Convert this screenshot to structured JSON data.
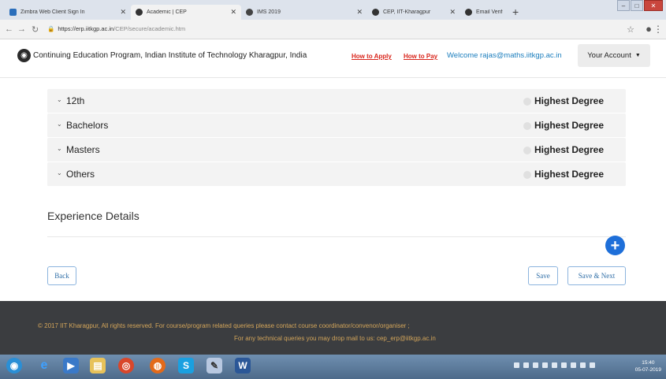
{
  "browser": {
    "tabs": [
      {
        "title": "Zimbra Web Client Sign In",
        "color": "#2a6ebb"
      },
      {
        "title": "Academic | CEP",
        "color": "#333333"
      },
      {
        "title": "IMS 2019",
        "color": "#444444"
      },
      {
        "title": "CEP, IIT-Kharagpur",
        "color": "#333333"
      },
      {
        "title": "Email Verification Link Sent",
        "color": "#333333"
      }
    ],
    "url_domain": "https://erp.iitkgp.ac.in",
    "url_path": "/CEP/secure/academic.htm"
  },
  "header": {
    "site_title": "Continuing Education Program, Indian Institute of Technology Kharagpur, India",
    "how_to_apply": "How to Apply",
    "how_to_pay": "How to Pay",
    "welcome": "Welcome rajas@maths.iitkgp.ac.in",
    "account_button": "Your Account"
  },
  "degrees": [
    {
      "label": "12th",
      "highest": "Highest Degree"
    },
    {
      "label": "Bachelors",
      "highest": "Highest Degree"
    },
    {
      "label": "Masters",
      "highest": "Highest Degree"
    },
    {
      "label": "Others",
      "highest": "Highest Degree"
    }
  ],
  "experience": {
    "title": "Experience Details"
  },
  "buttons": {
    "back": "Back",
    "save": "Save",
    "save_next": "Save & Next"
  },
  "footer": {
    "line1": "© 2017 IIT Kharagpur, All rights reserved.  For course/program related queries please contact course coordinator/convenor/organiser ;",
    "line2": "For any technical queries you may drop mail to us: cep_erp@iitkgp.ac.in"
  },
  "taskbar": {
    "time": "15:40",
    "date": "05-07-2019"
  },
  "colors": {
    "accent": "#1e6fd9",
    "link_red": "#d9261c",
    "footer_bg": "#3b3d40",
    "footer_text": "#d3a55a"
  }
}
